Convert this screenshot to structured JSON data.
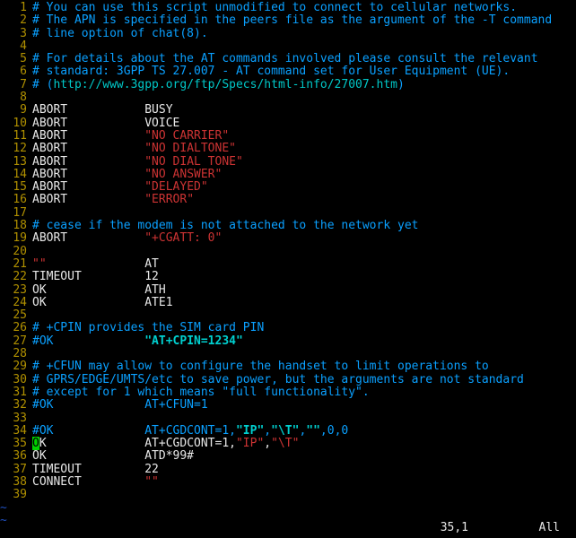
{
  "status": {
    "pos": "35,1",
    "pct": "All"
  },
  "tildes": [
    "~",
    "~"
  ],
  "lines": [
    {
      "n": 1,
      "tokens": [
        [
          "# You can use this script unmodified to connect to cellular networks.",
          "c-comment"
        ]
      ]
    },
    {
      "n": 2,
      "tokens": [
        [
          "# The APN is specified in the peers file as the argument of the -T command",
          "c-comment"
        ]
      ]
    },
    {
      "n": 3,
      "tokens": [
        [
          "# line option of chat(8).",
          "c-comment"
        ]
      ]
    },
    {
      "n": 4,
      "tokens": []
    },
    {
      "n": 5,
      "tokens": [
        [
          "# For details about the AT commands involved please consult the relevant",
          "c-comment"
        ]
      ]
    },
    {
      "n": 6,
      "tokens": [
        [
          "# standard: 3GPP TS 27.007 - AT command set for User Equipment (UE).",
          "c-comment"
        ]
      ]
    },
    {
      "n": 7,
      "tokens": [
        [
          "# (",
          "c-comment"
        ],
        [
          "http://www.3gpp.org/ftp/Specs/html-info/27007.htm",
          "c-cyan"
        ],
        [
          ")",
          "c-comment"
        ]
      ]
    },
    {
      "n": 8,
      "tokens": []
    },
    {
      "n": 9,
      "tokens": [
        [
          "ABORT           BUSY",
          "c-white"
        ]
      ]
    },
    {
      "n": 10,
      "tokens": [
        [
          "ABORT           VOICE",
          "c-white"
        ]
      ]
    },
    {
      "n": 11,
      "tokens": [
        [
          "ABORT           ",
          "c-white"
        ],
        [
          "\"NO CARRIER\"",
          "c-red"
        ]
      ]
    },
    {
      "n": 12,
      "tokens": [
        [
          "ABORT           ",
          "c-white"
        ],
        [
          "\"NO DIALTONE\"",
          "c-red"
        ]
      ]
    },
    {
      "n": 13,
      "tokens": [
        [
          "ABORT           ",
          "c-white"
        ],
        [
          "\"NO DIAL TONE\"",
          "c-red"
        ]
      ]
    },
    {
      "n": 14,
      "tokens": [
        [
          "ABORT           ",
          "c-white"
        ],
        [
          "\"NO ANSWER\"",
          "c-red"
        ]
      ]
    },
    {
      "n": 15,
      "tokens": [
        [
          "ABORT           ",
          "c-white"
        ],
        [
          "\"DELAYED\"",
          "c-red"
        ]
      ]
    },
    {
      "n": 16,
      "tokens": [
        [
          "ABORT           ",
          "c-white"
        ],
        [
          "\"ERROR\"",
          "c-red"
        ]
      ]
    },
    {
      "n": 17,
      "tokens": []
    },
    {
      "n": 18,
      "tokens": [
        [
          "# cease if the modem is not attached to the network yet",
          "c-comment"
        ]
      ]
    },
    {
      "n": 19,
      "tokens": [
        [
          "ABORT           ",
          "c-white"
        ],
        [
          "\"+CGATT: 0\"",
          "c-red"
        ]
      ]
    },
    {
      "n": 20,
      "tokens": []
    },
    {
      "n": 21,
      "tokens": [
        [
          "\"\"",
          "c-red"
        ],
        [
          "              AT",
          "c-white"
        ]
      ]
    },
    {
      "n": 22,
      "tokens": [
        [
          "TIMEOUT         12",
          "c-white"
        ]
      ]
    },
    {
      "n": 23,
      "tokens": [
        [
          "OK              ATH",
          "c-white"
        ]
      ]
    },
    {
      "n": 24,
      "tokens": [
        [
          "OK              ATE1",
          "c-white"
        ]
      ]
    },
    {
      "n": 25,
      "tokens": []
    },
    {
      "n": 26,
      "tokens": [
        [
          "# +CPIN provides the SIM card PIN",
          "c-comment"
        ]
      ]
    },
    {
      "n": 27,
      "tokens": [
        [
          "#OK             ",
          "c-comment"
        ],
        [
          "\"AT+CPIN=1234\"",
          "c-cyanbold"
        ]
      ]
    },
    {
      "n": 28,
      "tokens": []
    },
    {
      "n": 29,
      "tokens": [
        [
          "# +CFUN may allow to configure the handset to limit operations to",
          "c-comment"
        ]
      ]
    },
    {
      "n": 30,
      "tokens": [
        [
          "# GPRS/EDGE/UMTS/etc to save power, but the arguments are not standard",
          "c-comment"
        ]
      ]
    },
    {
      "n": 31,
      "tokens": [
        [
          "# except for 1 which means \"full functionality\".",
          "c-comment"
        ]
      ]
    },
    {
      "n": 32,
      "tokens": [
        [
          "#OK             AT+CFUN=1",
          "c-comment"
        ]
      ]
    },
    {
      "n": 33,
      "tokens": []
    },
    {
      "n": 34,
      "tokens": [
        [
          "#OK             AT+CGDCONT=1,",
          "c-comment"
        ],
        [
          "\"IP\"",
          "c-cyanbold"
        ],
        [
          ",",
          "c-comment"
        ],
        [
          "\"\\T\"",
          "c-cyanbold"
        ],
        [
          ",",
          "c-comment"
        ],
        [
          "\"\"",
          "c-cyanbold"
        ],
        [
          ",0,0",
          "c-comment"
        ]
      ]
    },
    {
      "n": 35,
      "cursor": true,
      "tokens": [
        [
          "O",
          "cursor"
        ],
        [
          "K              AT+CGDCONT=1,",
          "c-white"
        ],
        [
          "\"IP\"",
          "c-red"
        ],
        [
          ",",
          "c-white"
        ],
        [
          "\"\\T\"",
          "c-red"
        ]
      ]
    },
    {
      "n": 36,
      "tokens": [
        [
          "OK              ATD*99#",
          "c-white"
        ]
      ]
    },
    {
      "n": 37,
      "tokens": [
        [
          "TIMEOUT         22",
          "c-white"
        ]
      ]
    },
    {
      "n": 38,
      "tokens": [
        [
          "CONNECT         ",
          "c-white"
        ],
        [
          "\"\"",
          "c-red"
        ]
      ]
    },
    {
      "n": 39,
      "tokens": []
    }
  ]
}
